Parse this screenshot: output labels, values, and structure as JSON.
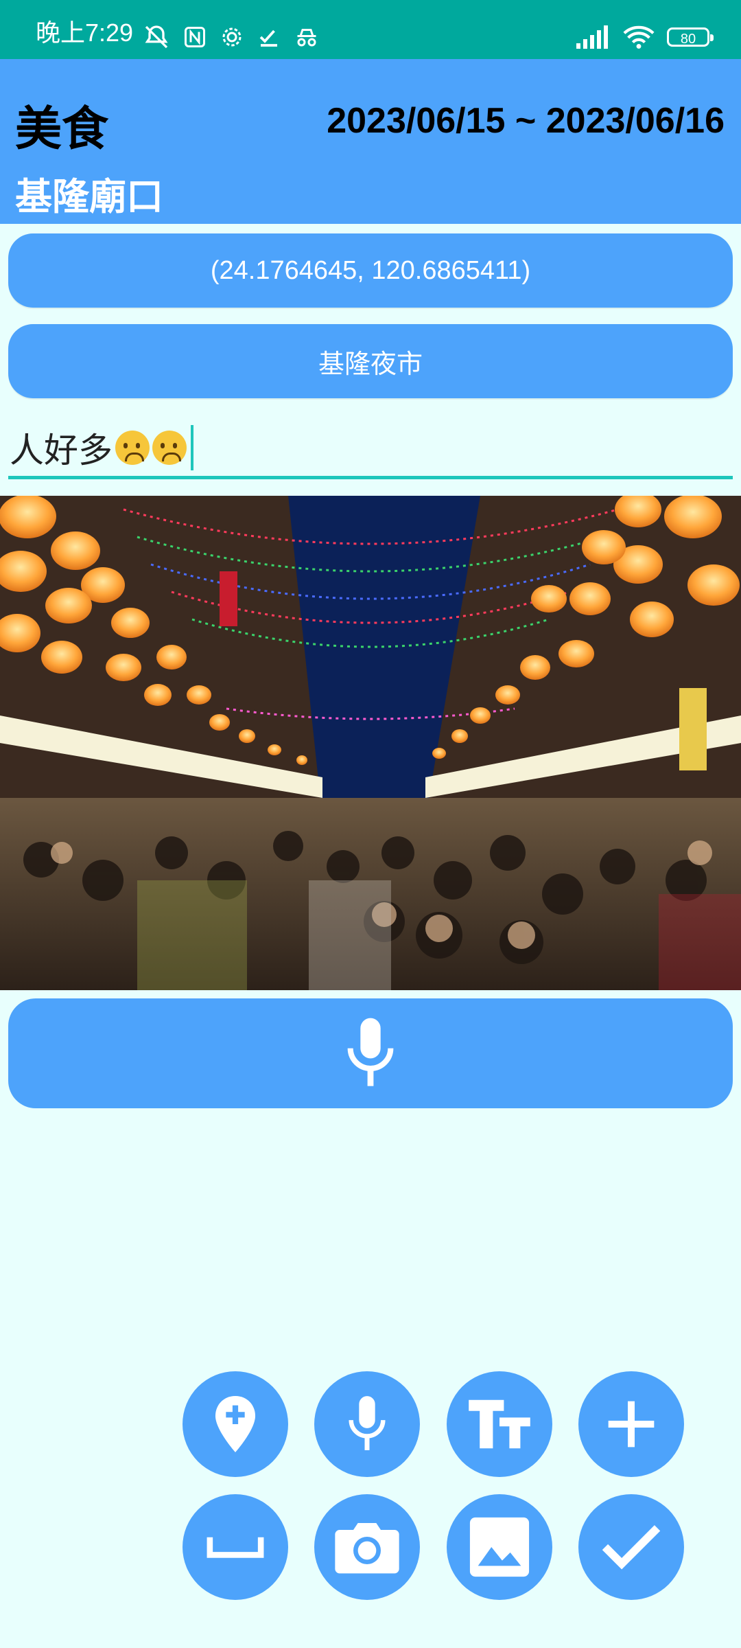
{
  "status_bar": {
    "time": "晚上7:29",
    "battery": "80"
  },
  "header": {
    "category": "美食",
    "date_range": "2023/06/15 ~ 2023/06/16",
    "place": "基隆廟口"
  },
  "location": {
    "coordinates": "(24.1764645, 120.6865411)",
    "place_name": "基隆夜市"
  },
  "note": {
    "text": "人好多"
  },
  "photo": {
    "subject": "night-market-photo"
  },
  "colors": {
    "status_bar": "#00a99d",
    "primary": "#4da3fb",
    "background": "#e8fffd",
    "accent": "#1ec6bb"
  },
  "actions": {
    "row1": [
      "add-location-icon",
      "mic-icon",
      "text-format-icon",
      "add-icon"
    ],
    "row2": [
      "space-bar-icon",
      "camera-icon",
      "image-icon",
      "check-icon"
    ]
  }
}
